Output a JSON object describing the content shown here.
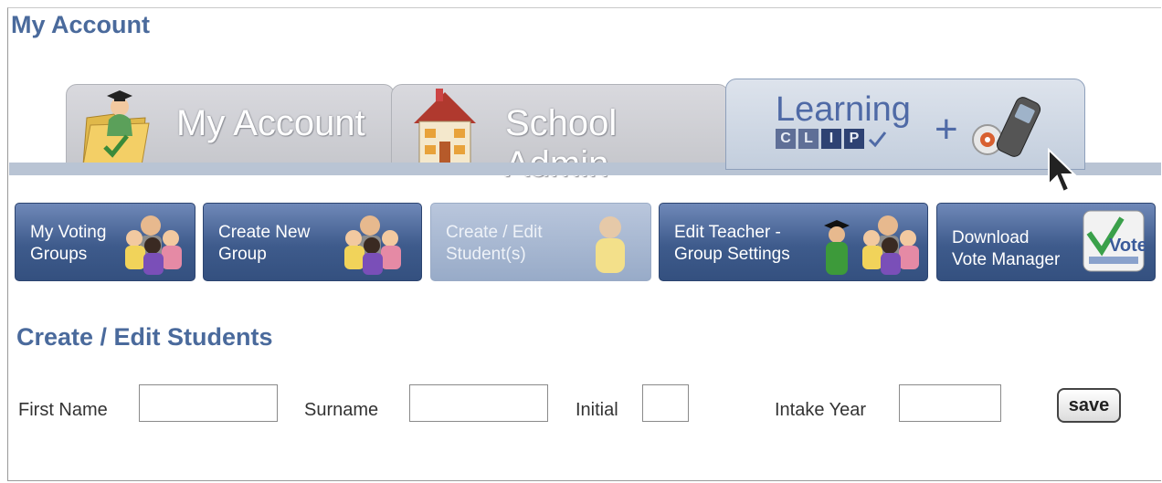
{
  "page_title": "My Account",
  "tabs": [
    {
      "label": "My Account",
      "icon": "folder-graduate-icon"
    },
    {
      "label": "School Admin",
      "icon": "school-house-icon"
    },
    {
      "logo_word": "Learning",
      "logo_letters": [
        "C",
        "L",
        "I",
        "P"
      ],
      "plus": "+",
      "icon": "voting-handset-icon"
    }
  ],
  "nav": [
    {
      "label": "My Voting\nGroups",
      "icon": "group-people-icon"
    },
    {
      "label": "Create New\nGroup",
      "icon": "group-people-icon"
    },
    {
      "label": "Create / Edit\nStudent(s)",
      "icon": "student-icon"
    },
    {
      "label": "Edit Teacher -\nGroup Settings",
      "icon": "teacher-group-icon"
    },
    {
      "label": "Download\nVote Manager",
      "icon": "vote-logo-icon",
      "logo_text": "Vote"
    }
  ],
  "section_title": "Create / Edit Students",
  "form": {
    "first_name_label": "First Name",
    "first_name_value": "",
    "surname_label": "Surname",
    "surname_value": "",
    "initial_label": "Initial",
    "initial_value": "",
    "intake_year_label": "Intake Year",
    "intake_year_value": "",
    "save_label": "save"
  },
  "colors": {
    "accent": "#4a6a9c",
    "button": "#3e5b8c",
    "button_disabled": "#a9b9d3",
    "tab_active": "#c9d3e1"
  }
}
